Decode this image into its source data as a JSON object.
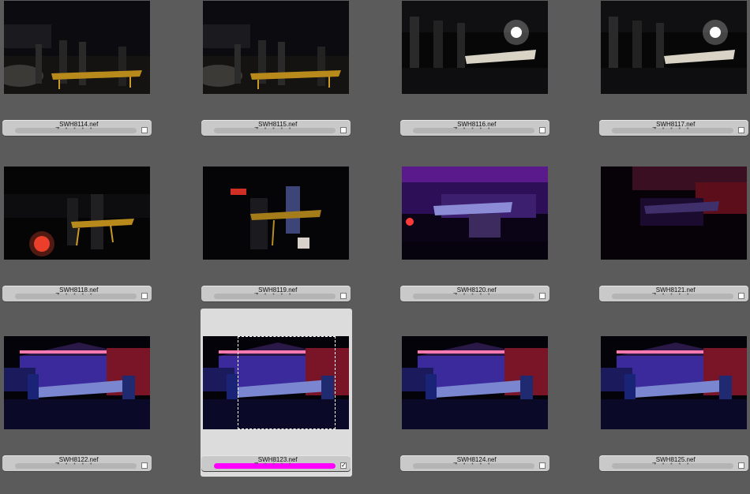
{
  "thumbnails": [
    {
      "filename": "_SWH8114.nef",
      "rating_dots": "• • • • •",
      "checked": false,
      "selected": false,
      "tone": "dark-warm"
    },
    {
      "filename": "_SWH8115.nef",
      "rating_dots": "• • • • •",
      "checked": false,
      "selected": false,
      "tone": "dark-warm"
    },
    {
      "filename": "_SWH8116.nef",
      "rating_dots": "• • • • •",
      "checked": false,
      "selected": false,
      "tone": "dark-flash"
    },
    {
      "filename": "_SWH8117.nef",
      "rating_dots": "• • • • •",
      "checked": false,
      "selected": false,
      "tone": "dark-flash"
    },
    {
      "filename": "_SWH8118.nef",
      "rating_dots": "• • • • •",
      "checked": false,
      "selected": false,
      "tone": "dark-red"
    },
    {
      "filename": "_SWH8119.nef",
      "rating_dots": "• • • • •",
      "checked": false,
      "selected": false,
      "tone": "dark-blur"
    },
    {
      "filename": "_SWH8120.nef",
      "rating_dots": "• • • • •",
      "checked": false,
      "selected": false,
      "tone": "purple"
    },
    {
      "filename": "_SWH8121.nef",
      "rating_dots": "• • • • •",
      "checked": false,
      "selected": false,
      "tone": "purple-dark"
    },
    {
      "filename": "_SWH8122.nef",
      "rating_dots": "• • • • •",
      "checked": false,
      "selected": false,
      "tone": "blue-house"
    },
    {
      "filename": "_SWH8123.nef",
      "rating_dots": "• • • • •",
      "checked": true,
      "selected": true,
      "tone": "blue-house"
    },
    {
      "filename": "_SWH8124.nef",
      "rating_dots": "• • • • •",
      "checked": false,
      "selected": false,
      "tone": "blue-house"
    },
    {
      "filename": "_SWH8125.nef",
      "rating_dots": "• • • • •",
      "checked": false,
      "selected": false,
      "tone": "blue-house"
    }
  ],
  "colors": {
    "background": "#5b5b5b",
    "selection_bg": "#dcdcdc",
    "label_bar": "#c9c9c9",
    "rating_track": "#b4b4b4",
    "color_label_magenta": "#ff00ff"
  },
  "check_glyph": "✓"
}
